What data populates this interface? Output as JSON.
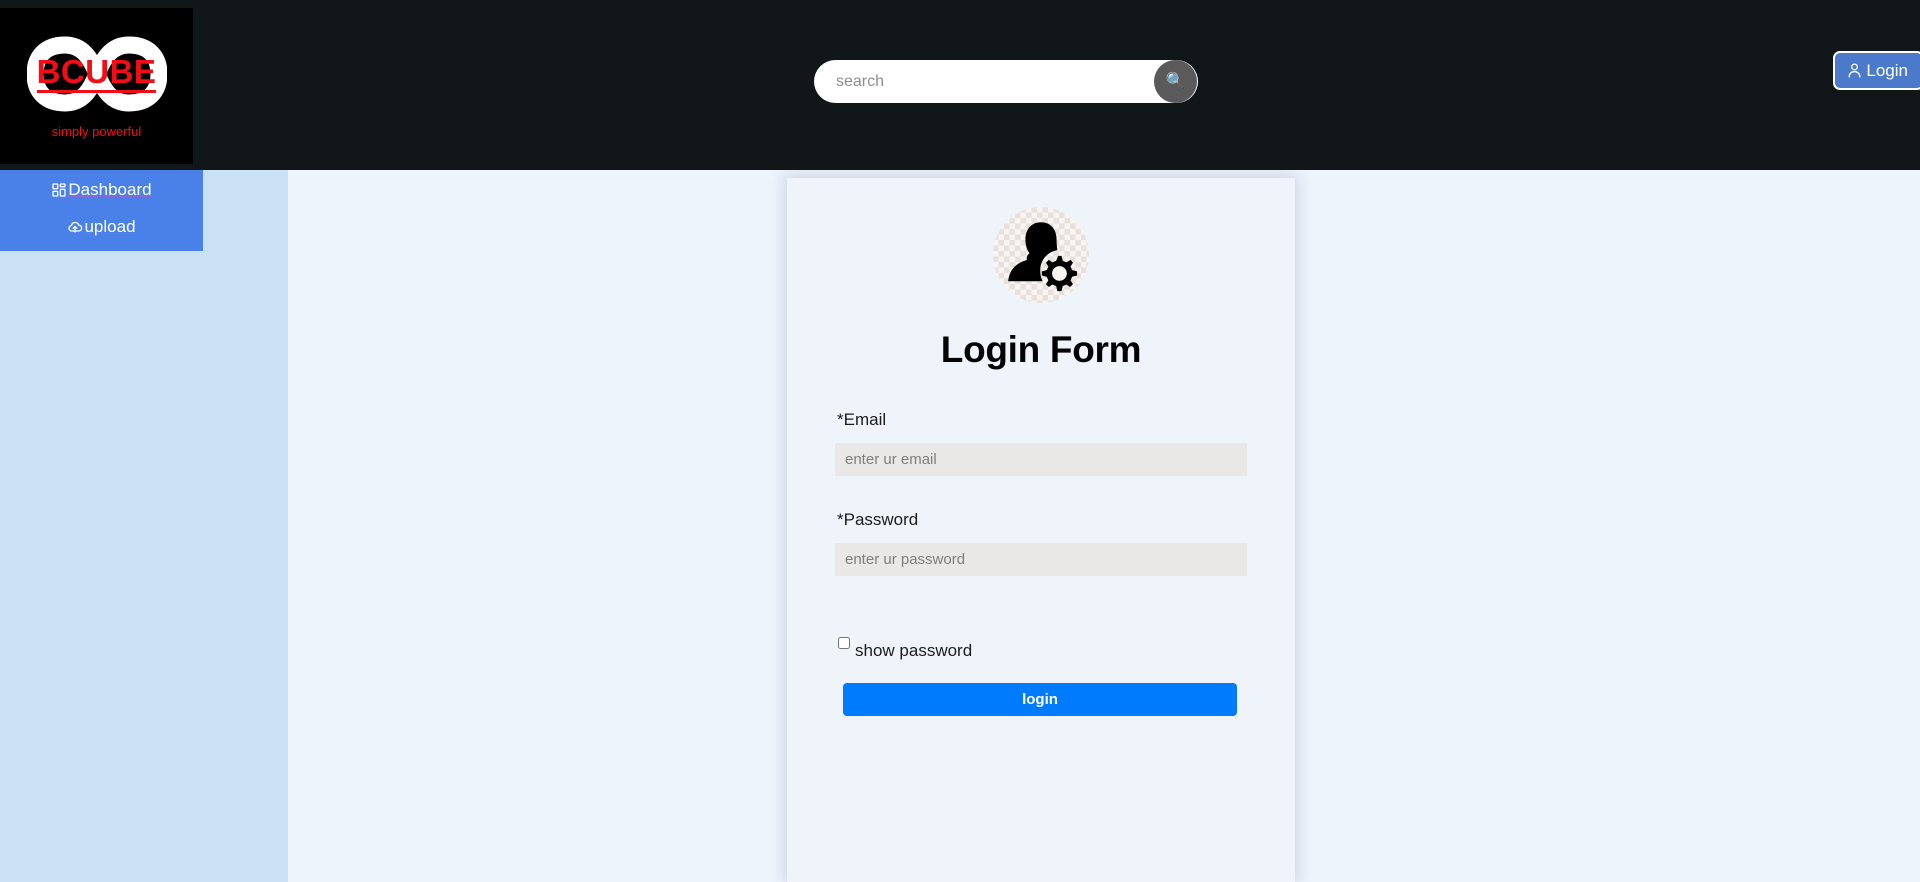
{
  "brand": {
    "name": "BCUBE",
    "tagline": "simply powerful",
    "logo_color": "#f40d16",
    "logo_bg": "#000000"
  },
  "header": {
    "background": "#111619",
    "search": {
      "placeholder": "search",
      "value": "",
      "button_icon": "search-icon",
      "button_glyph": "🔍"
    },
    "login_button": {
      "label": "Login",
      "icon": "person-icon",
      "background": "#4a7ac9"
    }
  },
  "sidebar": {
    "background": "#c9e0f5",
    "nav_background": "#4a81e8",
    "items": [
      {
        "label": "Dashboard",
        "icon": "dashboard-grid-icon"
      },
      {
        "label": "upload",
        "icon": "cloud-upload-icon"
      }
    ]
  },
  "main": {
    "background": "#eef4fc",
    "card": {
      "background": "#eff4fb",
      "avatar_icon": "user-settings-avatar-icon",
      "title": "Login Form",
      "fields": [
        {
          "label": "*Email",
          "placeholder": "enter ur email",
          "value": "",
          "type": "email",
          "name": "email-field"
        },
        {
          "label": "*Password",
          "placeholder": "enter ur password",
          "value": "",
          "type": "password",
          "name": "password-field"
        }
      ],
      "show_password": {
        "label": "show password",
        "checked": false
      },
      "submit": {
        "label": "login",
        "background": "#007bfe"
      }
    }
  }
}
